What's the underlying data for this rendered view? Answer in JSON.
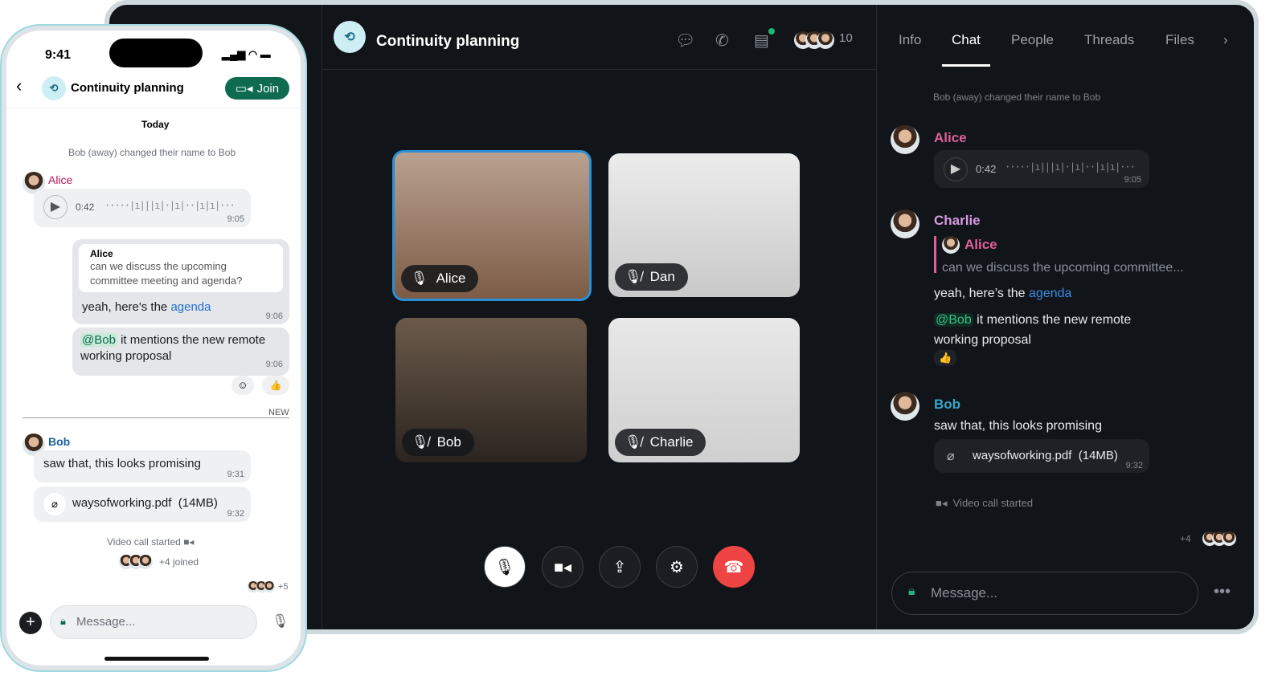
{
  "colors": {
    "accent_green": "#0f6b4f",
    "alice": "#e0609a",
    "charlie": "#d99ae0",
    "bob": "#3aa6c9",
    "link": "#3b8de8",
    "end_call": "#ef4444"
  },
  "desktop": {
    "title": "Continuity planning",
    "participant_count": "10",
    "header_icons": [
      "chat-bubble-icon",
      "phone-icon",
      "threads-icon"
    ],
    "tabs": [
      {
        "label": "Info"
      },
      {
        "label": "Chat",
        "active": true
      },
      {
        "label": "People"
      },
      {
        "label": "Threads"
      },
      {
        "label": "Files"
      }
    ],
    "tiles": [
      {
        "name": "Alice",
        "mic": "on",
        "active": true
      },
      {
        "name": "Dan",
        "mic": "muted"
      },
      {
        "name": "Bob",
        "mic": "muted"
      },
      {
        "name": "Charlie",
        "mic": "muted"
      }
    ],
    "controls": [
      "mic-muted",
      "camera",
      "share-screen",
      "settings",
      "end-call"
    ],
    "chat": {
      "system": "Bob (away) changed their name to Bob",
      "alice": {
        "name": "Alice",
        "duration": "0:42",
        "time": "9:05"
      },
      "charlie": {
        "name": "Charlie",
        "quote_name": "Alice",
        "quote_text": "can we discuss the upcoming committee...",
        "text_pre": "yeah, here’s the ",
        "link": "agenda",
        "mention": "@Bob",
        "mention_text": " it mentions the new remote working proposal",
        "reaction": "👍"
      },
      "bob": {
        "name": "Bob",
        "text": "saw that, this looks promising",
        "file": "waysofworking.pdf",
        "size": "(14MB)",
        "time": "9:32"
      },
      "video_started": "Video call started",
      "readers_more": "+4",
      "placeholder": "Message..."
    }
  },
  "phone": {
    "clock": "9:41",
    "title": "Continuity planning",
    "join": "Join",
    "today": "Today",
    "system": "Bob (away) changed their name to Bob",
    "alice": {
      "name": "Alice",
      "duration": "0:42",
      "time": "9:05"
    },
    "reply": {
      "quote_name": "Alice",
      "quote_text": "can we discuss the upcoming committee meeting and agenda?",
      "text_pre": "yeah, here's the ",
      "link": "agenda",
      "time": "9:06"
    },
    "mention": {
      "tag": "@Bob",
      "text": " it mentions the new remote working proposal",
      "time": "9:06"
    },
    "reaction": "👍",
    "new_label": "NEW",
    "bob": {
      "name": "Bob",
      "text": "saw that, this looks promising",
      "time": "9:31",
      "file": "waysofworking.pdf  (14MB)",
      "file_time": "9:32"
    },
    "video_started": "Video call started",
    "joined": "+4 joined",
    "readers_more": "+5",
    "placeholder": "Message..."
  }
}
